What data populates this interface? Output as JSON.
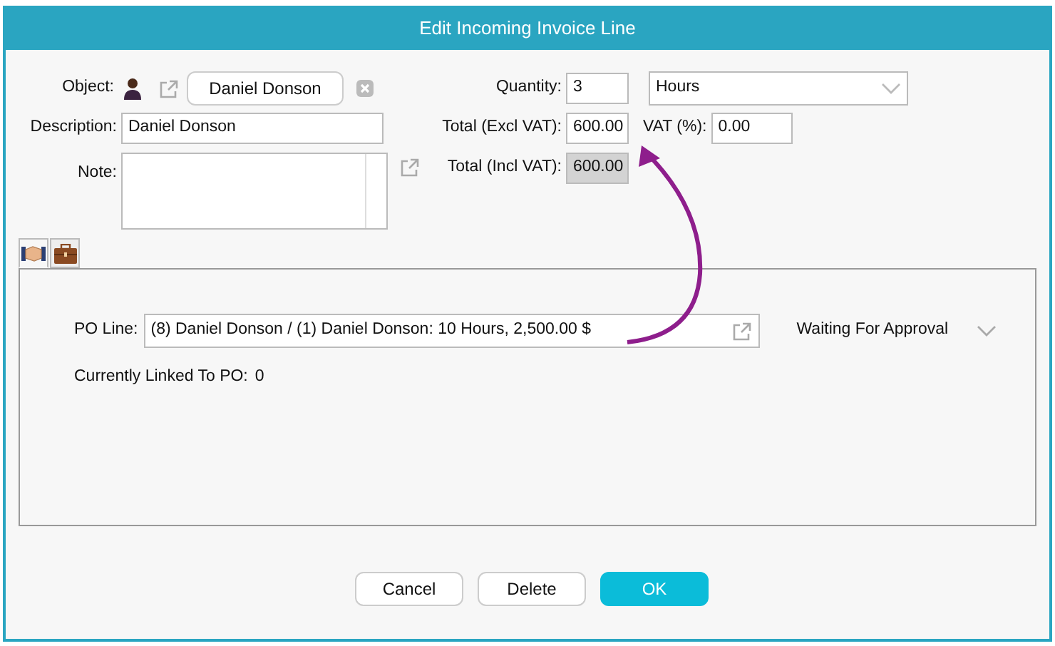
{
  "window": {
    "title": "Edit Incoming Invoice Line"
  },
  "form": {
    "object": {
      "label": "Object:",
      "value": "Daniel Donson"
    },
    "description": {
      "label": "Description:",
      "value": "Daniel Donson"
    },
    "note": {
      "label": "Note:"
    },
    "quantity": {
      "label": "Quantity:",
      "value": "3"
    },
    "unit": {
      "value": "Hours"
    },
    "total_excl": {
      "label": "Total (Excl VAT):",
      "value": "600.00"
    },
    "vat": {
      "label": "VAT (%):",
      "value": "0.00"
    },
    "total_incl": {
      "label": "Total (Incl VAT):",
      "value": "600.00",
      "disabled": true
    }
  },
  "tabs": [
    {
      "kind": "handshake",
      "selected": true
    },
    {
      "kind": "briefcase",
      "selected": false
    }
  ],
  "po_panel": {
    "po_line": {
      "label": "PO Line:",
      "value": "(8) Daniel Donson / (1) Daniel Donson: 10 Hours, 2,500.00 $"
    },
    "status": "Waiting For Approval",
    "linked": {
      "label": "Currently Linked To PO:",
      "value": "0"
    }
  },
  "buttons": [
    {
      "label": "Cancel",
      "primary": false
    },
    {
      "label": "Delete",
      "primary": false
    },
    {
      "label": "OK",
      "primary": true
    }
  ]
}
